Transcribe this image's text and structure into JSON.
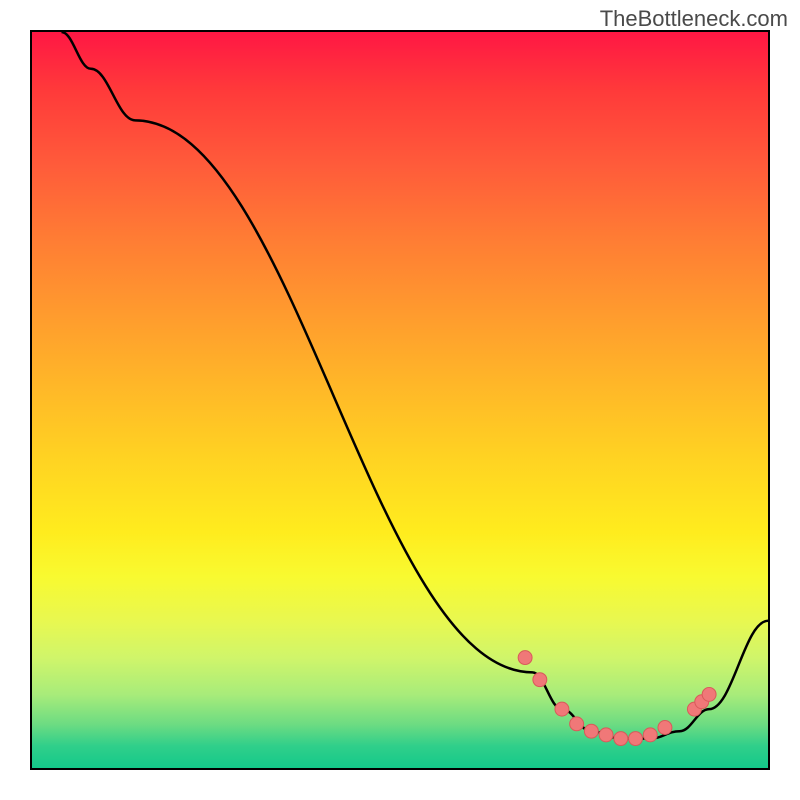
{
  "watermark": "TheBottleneck.com",
  "chart_data": {
    "type": "line",
    "title": "",
    "xlabel": "",
    "ylabel": "",
    "xlim": [
      0,
      100
    ],
    "ylim": [
      0,
      100
    ],
    "curve": [
      {
        "x": 4,
        "y": 100
      },
      {
        "x": 8,
        "y": 95
      },
      {
        "x": 14,
        "y": 88
      },
      {
        "x": 68,
        "y": 13
      },
      {
        "x": 72,
        "y": 8
      },
      {
        "x": 76,
        "y": 5
      },
      {
        "x": 80,
        "y": 4
      },
      {
        "x": 84,
        "y": 4
      },
      {
        "x": 88,
        "y": 5
      },
      {
        "x": 92,
        "y": 8
      },
      {
        "x": 100,
        "y": 20
      }
    ],
    "markers": [
      {
        "x": 67,
        "y": 15
      },
      {
        "x": 69,
        "y": 12
      },
      {
        "x": 72,
        "y": 8
      },
      {
        "x": 74,
        "y": 6
      },
      {
        "x": 76,
        "y": 5
      },
      {
        "x": 78,
        "y": 4.5
      },
      {
        "x": 80,
        "y": 4
      },
      {
        "x": 82,
        "y": 4
      },
      {
        "x": 84,
        "y": 4.5
      },
      {
        "x": 86,
        "y": 5.5
      },
      {
        "x": 90,
        "y": 8
      },
      {
        "x": 91,
        "y": 9
      },
      {
        "x": 92,
        "y": 10
      }
    ],
    "gradient_stops": [
      {
        "pos": 0,
        "color": "#ff1744"
      },
      {
        "pos": 100,
        "color": "#14c98a"
      }
    ]
  }
}
